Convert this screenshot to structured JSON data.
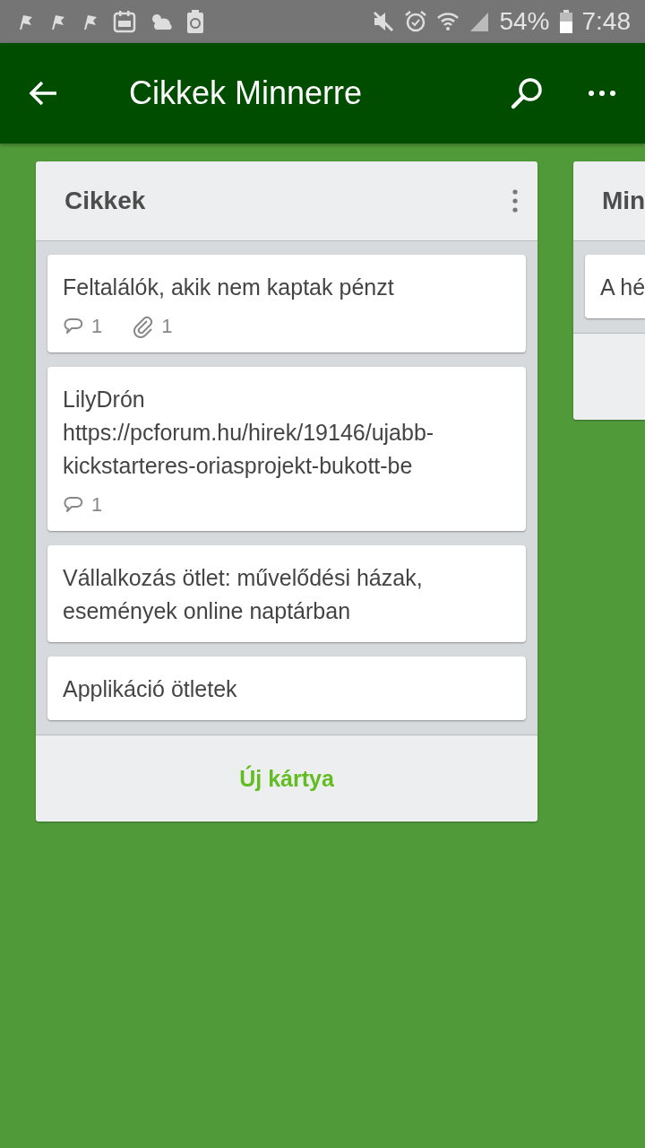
{
  "status_bar": {
    "battery": "54%",
    "time": "7:48"
  },
  "app_bar": {
    "title": "Cikkek Minnerre"
  },
  "lists": [
    {
      "title": "Cikkek",
      "cards": [
        {
          "title": "Feltalálók, akik nem kaptak pénzt",
          "badges": [
            {
              "kind": "comment",
              "count": "1"
            },
            {
              "kind": "attachment",
              "count": "1"
            }
          ]
        },
        {
          "title": "LilyDrón https://pcforum.hu/hirek/19146/ujabb-kickstarteres-oriasprojekt-bukott-be",
          "badges": [
            {
              "kind": "comment",
              "count": "1"
            }
          ]
        },
        {
          "title": "Vállalkozás ötlet: művelődési házak, események online naptárban"
        },
        {
          "title": "Applikáció ötletek"
        }
      ],
      "add_card": "Új kártya"
    },
    {
      "title": "Min",
      "cards": [
        {
          "title": "A hé"
        }
      ]
    }
  ]
}
